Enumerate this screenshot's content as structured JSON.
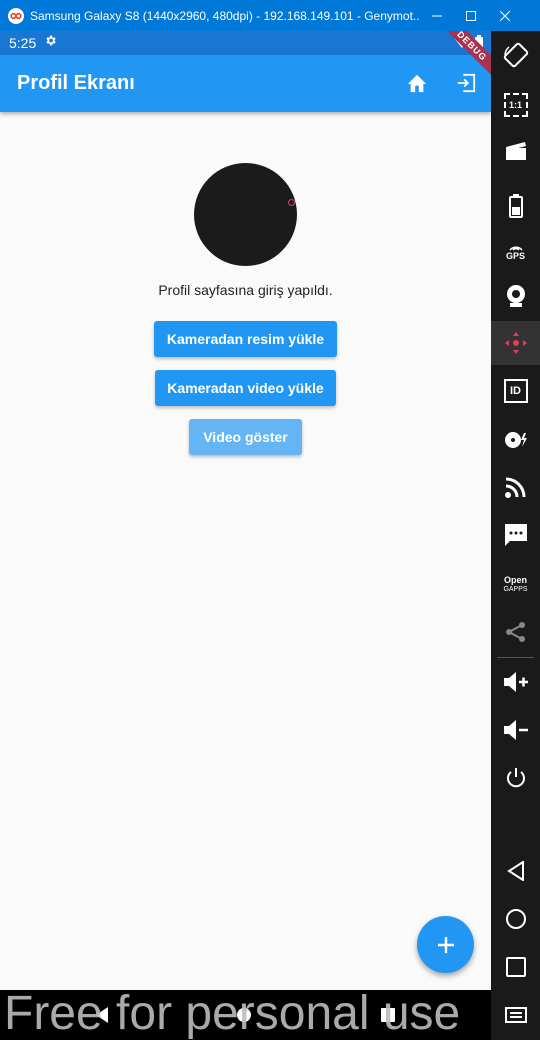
{
  "window": {
    "title": "Samsung Galaxy S8 (1440x2960, 480dpi) - 192.168.149.101 - Genymot..."
  },
  "status_bar": {
    "time": "5:25"
  },
  "app_bar": {
    "title": "Profil Ekranı"
  },
  "debug_banner": "DEBUG",
  "main": {
    "message": "Profil sayfasına giriş yapıldı.",
    "buttons": {
      "upload_image": "Kameradan resim yükle",
      "upload_video": "Kameradan video yükle",
      "show_video": "Video göster"
    }
  },
  "fab": {
    "label": "+"
  },
  "watermark": "Free for personal use",
  "sidebar": {
    "items": [
      "rotate-icon",
      "pixel-perfect-icon",
      "capture-icon",
      "battery-icon",
      "gps-icon",
      "camera-icon",
      "move-icon",
      "identifiers-icon",
      "disk-io-icon",
      "cast-icon",
      "sms-icon",
      "open-gapps-icon",
      "share-icon",
      "volume-up-icon",
      "volume-down-icon",
      "power-icon",
      "back-icon",
      "home-icon",
      "recents-icon",
      "menu-icon"
    ],
    "labels": {
      "pixel": "1:1",
      "gps": "GPS",
      "id": "ID",
      "open": "Open",
      "gapps": "GAPPS"
    }
  },
  "colors": {
    "primary": "#2196f3",
    "status_bar": "#1976d2",
    "accent": "#e83a5a"
  }
}
